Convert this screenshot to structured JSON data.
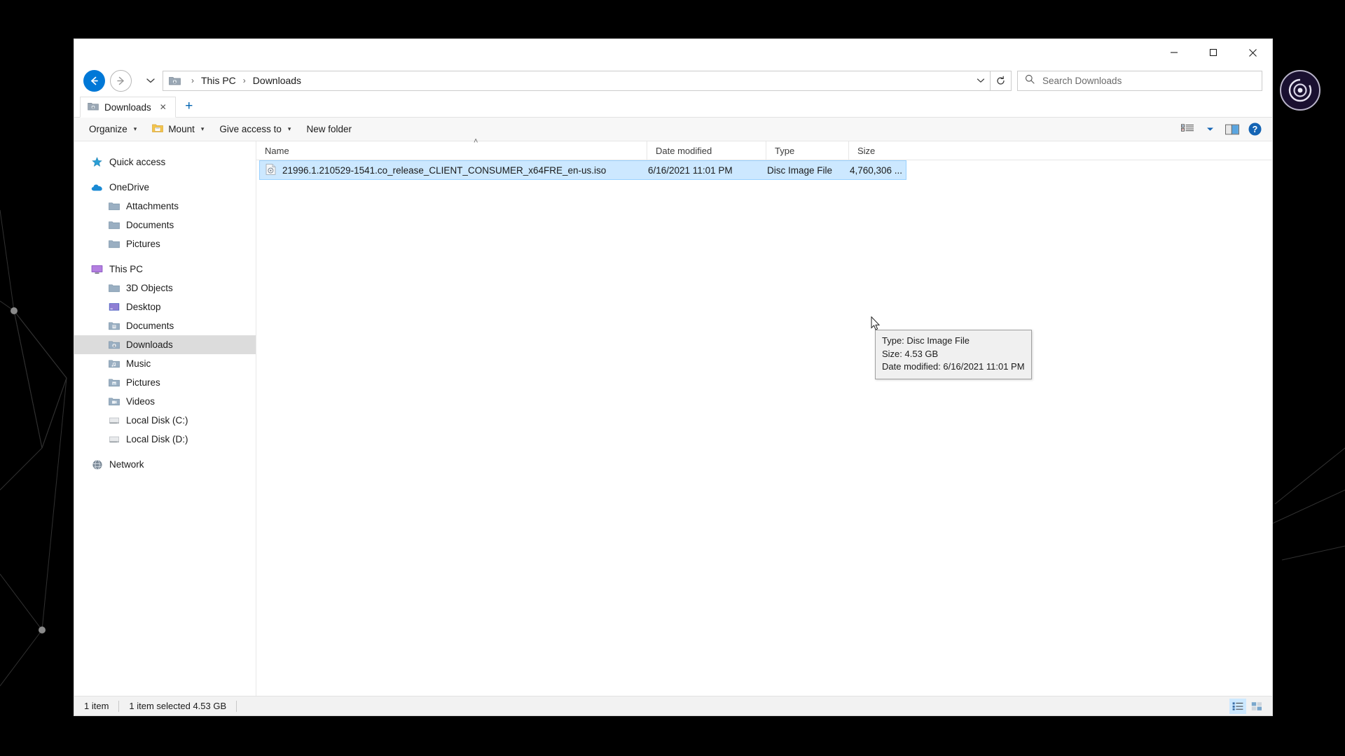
{
  "window": {
    "title": "Downloads",
    "caption_buttons": [
      {
        "name": "minimize",
        "glyph": "─"
      },
      {
        "name": "maximize",
        "glyph": "❐"
      },
      {
        "name": "close",
        "glyph": "✕"
      }
    ]
  },
  "navigation": {
    "back_label": "Back",
    "forward_label": "Forward",
    "recent_label": "Recent locations",
    "refresh_label": "Refresh",
    "address_dropdown_label": "Previous locations",
    "breadcrumbs": [
      {
        "label": "This PC"
      },
      {
        "label": "Downloads"
      }
    ],
    "separator": "›"
  },
  "search": {
    "placeholder": "Search Downloads",
    "value": ""
  },
  "tabs": [
    {
      "label": "Downloads",
      "close_glyph": "✕",
      "active": true
    }
  ],
  "new_tab_glyph": "+",
  "toolbar": {
    "items": [
      {
        "label": "Organize",
        "has_caret": true,
        "has_icon": false
      },
      {
        "label": "Mount",
        "has_caret": true,
        "has_icon": true
      },
      {
        "label": "Give access to",
        "has_caret": true,
        "has_icon": false
      },
      {
        "label": "New folder",
        "has_caret": false,
        "has_icon": false
      }
    ],
    "caret_glyph": "▾",
    "view_options_label": "View options",
    "preview_pane_label": "Preview pane",
    "help_label": "?"
  },
  "sidebar": {
    "items": [
      {
        "label": "Quick access",
        "icon": "star-icon",
        "level": 0,
        "selected": false,
        "gap_before": false
      },
      {
        "label": "OneDrive",
        "icon": "cloud-icon",
        "level": 0,
        "selected": false,
        "gap_before": true
      },
      {
        "label": "Attachments",
        "icon": "folder-icon",
        "level": 1,
        "selected": false,
        "gap_before": false
      },
      {
        "label": "Documents",
        "icon": "folder-icon",
        "level": 1,
        "selected": false,
        "gap_before": false
      },
      {
        "label": "Pictures",
        "icon": "folder-icon",
        "level": 1,
        "selected": false,
        "gap_before": false
      },
      {
        "label": "This PC",
        "icon": "monitor-icon",
        "level": 0,
        "selected": false,
        "gap_before": true
      },
      {
        "label": "3D Objects",
        "icon": "folder-icon",
        "level": 1,
        "selected": false,
        "gap_before": false
      },
      {
        "label": "Desktop",
        "icon": "desktop-icon",
        "level": 1,
        "selected": false,
        "gap_before": false
      },
      {
        "label": "Documents",
        "icon": "documents-folder-icon",
        "level": 1,
        "selected": false,
        "gap_before": false
      },
      {
        "label": "Downloads",
        "icon": "downloads-folder-icon",
        "level": 1,
        "selected": true,
        "gap_before": false
      },
      {
        "label": "Music",
        "icon": "music-folder-icon",
        "level": 1,
        "selected": false,
        "gap_before": false
      },
      {
        "label": "Pictures",
        "icon": "pictures-folder-icon",
        "level": 1,
        "selected": false,
        "gap_before": false
      },
      {
        "label": "Videos",
        "icon": "videos-folder-icon",
        "level": 1,
        "selected": false,
        "gap_before": false
      },
      {
        "label": "Local Disk (C:)",
        "icon": "drive-icon",
        "level": 1,
        "selected": false,
        "gap_before": false
      },
      {
        "label": "Local Disk (D:)",
        "icon": "drive-icon",
        "level": 1,
        "selected": false,
        "gap_before": false
      },
      {
        "label": "Network",
        "icon": "network-icon",
        "level": 0,
        "selected": false,
        "gap_before": true
      }
    ]
  },
  "filelist": {
    "columns": [
      {
        "key": "name",
        "label": "Name",
        "sorted": true,
        "sort_arrow": "˄"
      },
      {
        "key": "date",
        "label": "Date modified",
        "sorted": false
      },
      {
        "key": "type",
        "label": "Type",
        "sorted": false
      },
      {
        "key": "size",
        "label": "Size",
        "sorted": false
      }
    ],
    "rows": [
      {
        "name": "21996.1.210529-1541.co_release_CLIENT_CONSUMER_x64FRE_en-us.iso",
        "date": "6/16/2021 11:01 PM",
        "type": "Disc Image File",
        "size": "4,760,306 ...",
        "icon": "disc-image-file-icon",
        "selected": true
      }
    ]
  },
  "tooltip": {
    "lines": [
      "Type: Disc Image File",
      "Size: 4.53 GB",
      "Date modified: 6/16/2021 11:01 PM"
    ]
  },
  "statusbar": {
    "item_count": "1 item",
    "selection": "1 item selected  4.53 GB",
    "details_view_label": "Details view",
    "large_icons_view_label": "Large icons view"
  },
  "colors": {
    "accent": "#0078d7",
    "selection_fill": "#cce8ff",
    "selection_border": "#99d1ff",
    "sidebar_selected": "#dcdcdc",
    "commandbar_bg": "#f7f7f7",
    "statusbar_bg": "#f2f2f2",
    "help_blue": "#1464b4"
  }
}
